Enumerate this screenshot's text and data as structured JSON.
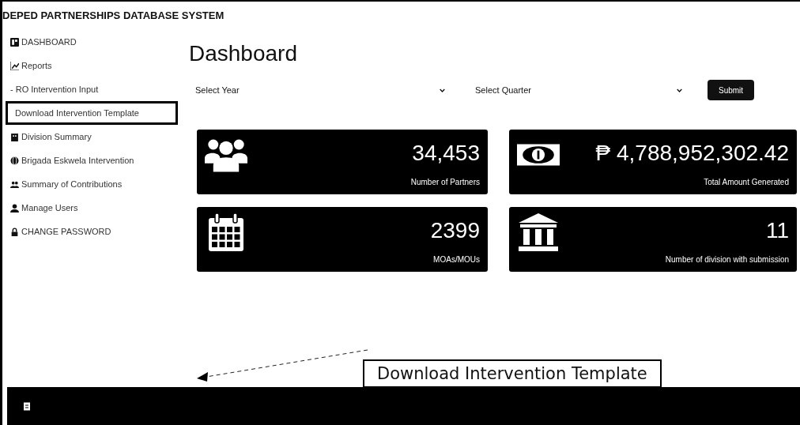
{
  "window": {
    "title": "DEPED PARTNERSHIPS DATABASE SYSTEM"
  },
  "sidebar": {
    "items": [
      {
        "label": "DASHBOARD",
        "kind": "dashboard",
        "highlighted": false
      },
      {
        "label": "Reports",
        "kind": "chart",
        "highlighted": false
      },
      {
        "label": "- RO Intervention Input",
        "kind": "plain",
        "highlighted": false
      },
      {
        "label": "Download Intervention Template",
        "kind": "plain",
        "highlighted": true
      },
      {
        "label": "Division Summary",
        "kind": "building",
        "highlighted": false
      },
      {
        "label": "Brigada Eskwela Intervention",
        "kind": "globe",
        "highlighted": false
      },
      {
        "label": "Summary of Contributions",
        "kind": "users",
        "highlighted": false
      },
      {
        "label": "Manage Users",
        "kind": "user",
        "highlighted": false
      },
      {
        "label": "CHANGE PASSWORD",
        "kind": "lock",
        "highlighted": false
      }
    ]
  },
  "page": {
    "heading": "Dashboard"
  },
  "filters": {
    "year": {
      "placeholder": "Select Year"
    },
    "quarter": {
      "placeholder": "Select Quarter"
    },
    "submit": "Submit"
  },
  "cards": [
    {
      "kind": "users",
      "value": "34,453",
      "label": "Number of Partners"
    },
    {
      "kind": "money",
      "value": "₱ 4,788,952,302.42",
      "label": "Total Amount Generated"
    },
    {
      "kind": "calendar",
      "value": "2399",
      "label": "MOAs/MOUs"
    },
    {
      "kind": "bank",
      "value": "11",
      "label": "Number of division with submission"
    }
  ],
  "callout": {
    "text": "Download Intervention Template"
  }
}
